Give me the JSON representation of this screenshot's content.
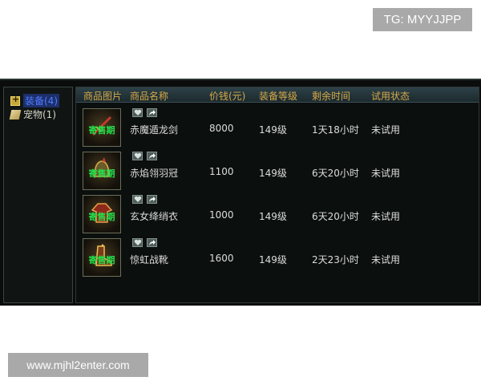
{
  "watermarks": {
    "telegram": "TG: MYYJJPP",
    "website": "www.mjhl2enter.com"
  },
  "sidebar": {
    "items": [
      {
        "label": "装备(4)",
        "icon": "equipment-icon",
        "selected": true
      },
      {
        "label": "宠物(1)",
        "icon": "pet-icon",
        "selected": false
      }
    ]
  },
  "table": {
    "headers": [
      "商品图片",
      "商品名称",
      "价钱(元)",
      "装备等级",
      "剩余时间",
      "试用状态"
    ],
    "rows": [
      {
        "thumb_tag": "寄售期",
        "thumb_icon": "sword-icon",
        "name": "赤魔遁龙剑",
        "price": "8000",
        "level": "149级",
        "remaining": "1天18小时",
        "status": "未试用"
      },
      {
        "thumb_tag": "寄售期",
        "thumb_icon": "helmet-icon",
        "name": "赤焰翎羽冠",
        "price": "1100",
        "level": "149级",
        "remaining": "6天20小时",
        "status": "未试用"
      },
      {
        "thumb_tag": "寄售期",
        "thumb_icon": "robe-icon",
        "name": "玄女绛绡衣",
        "price": "1000",
        "level": "149级",
        "remaining": "6天20小时",
        "status": "未试用"
      },
      {
        "thumb_tag": "寄售期",
        "thumb_icon": "boots-icon",
        "name": "惊虹战靴",
        "price": "1600",
        "level": "149级",
        "remaining": "2天23小时",
        "status": "未试用"
      }
    ]
  },
  "colors": {
    "header_text": "#d6a948",
    "tag_green": "#22e04a",
    "selected_blue": "#4f7cff"
  }
}
